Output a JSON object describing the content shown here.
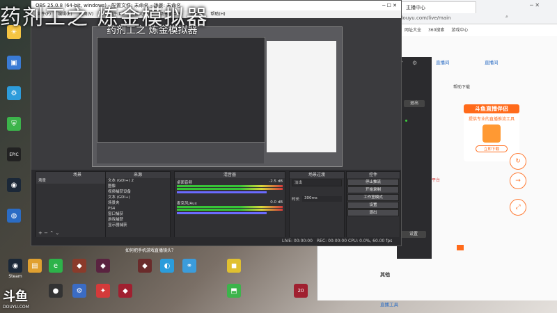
{
  "overlay": {
    "banner_title": "药剂工之 炼金模拟器",
    "nested_title": "药剂工之 炼金模拟器",
    "notice": "如何把手机游戏直播镜头？",
    "watermark": "斗鱼",
    "watermark_url": "DOUYU.COM"
  },
  "desktop": {
    "icons": [
      {
        "label": "",
        "icon": "sun-icon",
        "color": "#f5c542"
      },
      {
        "label": "",
        "icon": "folder-icon",
        "color": "#3a7bd5"
      },
      {
        "label": "",
        "icon": "gear-icon",
        "color": "#2d9cdb"
      },
      {
        "label": "",
        "icon": "shield-icon",
        "color": "#3cb44b"
      },
      {
        "label": "",
        "icon": "gamepad-icon",
        "color": "#e23b3b"
      },
      {
        "label": "EPIC",
        "icon": "epic-icon",
        "color": "#222222"
      },
      {
        "label": "",
        "icon": "steam-icon",
        "color": "#1b2838"
      },
      {
        "label": "",
        "icon": "globe-icon",
        "color": "#2b6cc4"
      },
      {
        "label": "",
        "icon": "chart-icon",
        "color": "#3cb44b"
      },
      {
        "label": "",
        "icon": "recycle-icon",
        "color": "#888888"
      }
    ],
    "bottom_icons": [
      {
        "label": "Steam",
        "icon": "steam-icon",
        "color": "#1b2838"
      },
      {
        "label": "",
        "icon": "folder-icon",
        "color": "#e0a030"
      },
      {
        "label": "",
        "icon": "browser-icon",
        "color": "#2db34a"
      },
      {
        "label": "",
        "icon": "game-icon",
        "color": "#8a3b2b"
      },
      {
        "label": "",
        "icon": "game-icon",
        "color": "#5a2340"
      },
      {
        "label": "",
        "icon": "game-icon",
        "color": "#6a2b2b"
      },
      {
        "label": "",
        "icon": "browser-icon",
        "color": "#2b9cdb"
      },
      {
        "label": "",
        "icon": "share-icon",
        "color": "#3b9cdb"
      },
      {
        "label": "",
        "icon": "app-icon",
        "color": "#e0c030"
      },
      {
        "label": "",
        "icon": "app-icon",
        "color": "#d43a3a"
      },
      {
        "label": "",
        "icon": "app-icon",
        "color": "#3cb44b"
      },
      {
        "label": "20",
        "icon": "app-icon",
        "color": "#a02030"
      }
    ]
  },
  "obs": {
    "title": "OBS 25.0.8 (64-bit, windows) - 配置文件: 未命名 - 场景: 未命名",
    "menu": [
      "文件(F)",
      "编辑(E)",
      "视图(V)",
      "停靠部件(D)",
      "配置文件(P)",
      "场景集合(S)",
      "工具(T)",
      "帮助(H)"
    ],
    "docks": {
      "scenes": "场景",
      "sources": "来源",
      "mixer": "混音器",
      "transitions": "场景过渡",
      "controls": "控件"
    },
    "scene_items": [
      "场景"
    ],
    "source_items": [
      "文本 (GDI+) 2",
      "图像",
      "视频捕获设备",
      "文本 (GDI+)",
      "场景夹",
      "PS4",
      "窗口捕获",
      "游戏捕获",
      "显示器捕获"
    ],
    "mixer_channels": [
      {
        "name": "桌面音频",
        "db": "-2.5 dB"
      },
      {
        "name": "麦克风/Aux",
        "db": "0.0 dB"
      }
    ],
    "transition": {
      "type": "淡出",
      "duration_label": "时长",
      "duration": "300ms"
    },
    "controls": [
      "停止推流",
      "开始录制",
      "工作室模式",
      "设置",
      "退出"
    ],
    "status": {
      "live": "LIVE: 00:00:00",
      "rec": "REC: 00:00:00",
      "cpu": "CPU: 0.0%, 60.00 fps"
    }
  },
  "browser": {
    "tab_title": "主播中心",
    "url": "douyu.com/live/main",
    "bookmarks": [
      "网址大全",
      "360搜索",
      "游戏中心"
    ],
    "content": {
      "nav_link": "直播间",
      "nav_link2": "直播间",
      "promo_title": "斗鱼直播伴侣",
      "promo_sub": "提供专业的直播推流工具",
      "promo_button": "立即下载",
      "text_download": "帮助下载",
      "red_note": "斗鱼直播平台",
      "body_lines": [
        "...",
        "...",
        "..."
      ],
      "footer_note": "其他",
      "footer_link": "直播工具"
    }
  },
  "panel": {
    "buttons": [
      "退出",
      "设置"
    ]
  }
}
